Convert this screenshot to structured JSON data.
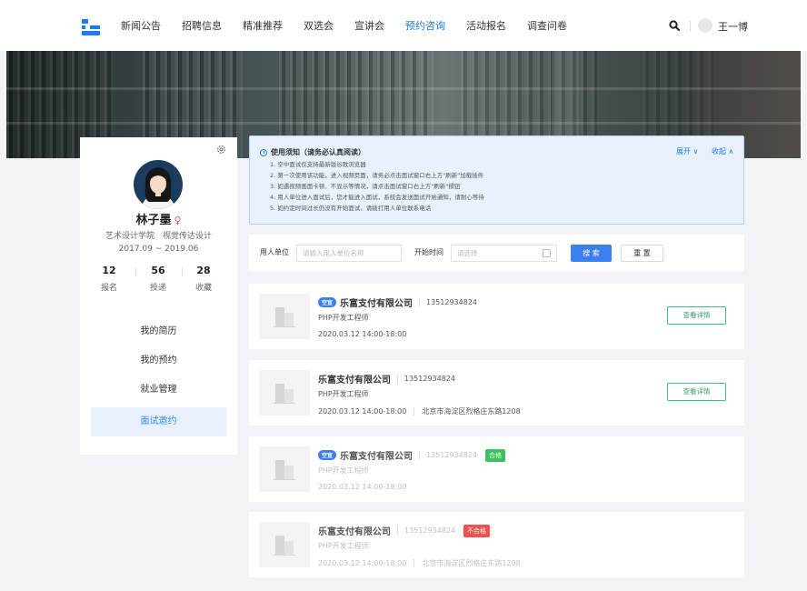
{
  "header": {
    "nav": [
      "新闻公告",
      "招聘信息",
      "精准推荐",
      "双选会",
      "宣讲会",
      "预约咨询",
      "活动报名",
      "调查问卷"
    ],
    "active_nav": "预约咨询",
    "user_name": "王一博",
    "accent": "#1e7bf0"
  },
  "profile": {
    "name": "林子墨",
    "gender_symbol": "♀",
    "department": "艺术设计学院　视觉传达设计",
    "period": "2017.09 ~ 2019.06",
    "stats": [
      {
        "value": "12",
        "label": "报名"
      },
      {
        "value": "56",
        "label": "投递"
      },
      {
        "value": "28",
        "label": "收藏"
      }
    ],
    "menu": [
      "我的简历",
      "我的预约",
      "就业管理",
      "面试邀约"
    ],
    "active_menu": "面试邀约"
  },
  "notice": {
    "title": "使用须知（请务必认真阅读）",
    "lines": [
      "1. 空中面试仅支持最新版谷歌浏览器",
      "2. 第一次使用该功能，进入视频页面，请务必点击面试窗口右上方\"刷新\"加载插件",
      "3. 如遇视频画面卡顿、不显示等情况，请点击面试窗口右上方\"刷新\"按钮",
      "4. 用人单位进入面试后，您才能进入面试，系统会发送面试开始通知，请耐心等待",
      "5. 如约定时间过长仍没有开始面试，请拨打用人单位联系电话"
    ],
    "expand_label": "展开 ∨",
    "collapse_label": "收起 ∧"
  },
  "filter": {
    "unit_label": "用人单位",
    "unit_placeholder": "请输入用人单位名称",
    "time_label": "开始时间",
    "time_placeholder": "请选择",
    "search_label": "搜 索",
    "reset_label": "重 置"
  },
  "cards": [
    {
      "tag": "空宣",
      "company": "乐富支付有限公司",
      "phone": "13512934824",
      "position": "PHP开发工程师",
      "time": "2020.03.12 14:00-18:00",
      "address": "",
      "result": "",
      "action": "查看详情"
    },
    {
      "tag": "",
      "company": "乐富支付有限公司",
      "phone": "13512934824",
      "position": "PHP开发工程师",
      "time": "2020.03.12 14:00-18:00",
      "address": "北京市海淀区烈格庄东路1208",
      "result": "",
      "action": "查看详情"
    },
    {
      "tag": "空宣",
      "company": "乐富支付有限公司",
      "phone": "13512934824",
      "position": "PHP开发工程师",
      "time": "2020.03.12 14:00-18:00",
      "address": "",
      "result": "合格",
      "action": ""
    },
    {
      "tag": "",
      "company": "乐富支付有限公司",
      "phone": "13512934824",
      "position": "PHP开发工程师",
      "time": "2020.03.12 14:00-18:00",
      "address": "北京市海淀区烈格庄东路1208",
      "result": "不合格",
      "action": ""
    }
  ]
}
